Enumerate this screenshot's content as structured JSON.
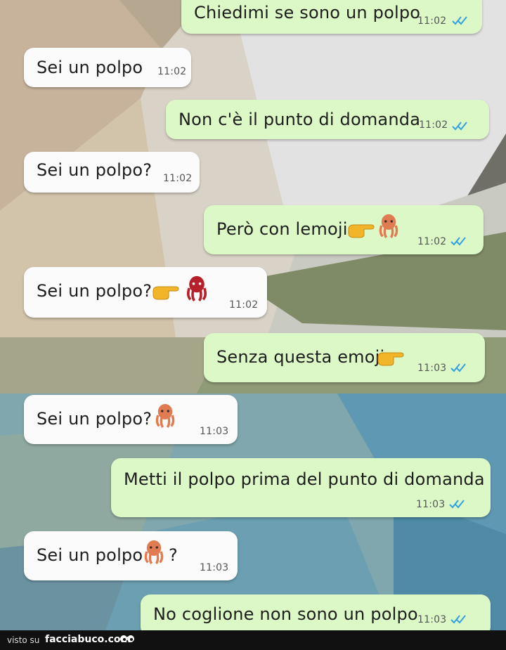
{
  "messages": [
    {
      "direction": "out",
      "text": "Chiedimi se sono un polpo",
      "time": "11:02"
    },
    {
      "direction": "in",
      "text": "Sei un polpo",
      "time": "11:02"
    },
    {
      "direction": "out",
      "text": "Non c'è il punto di domanda",
      "time": "11:02"
    },
    {
      "direction": "in",
      "text": "Sei un polpo?",
      "time": "11:02"
    },
    {
      "direction": "out",
      "text": "Però con lemoji",
      "time": "11:02",
      "emojis": [
        "pointing-right-hand",
        "octopus"
      ]
    },
    {
      "direction": "in",
      "text": "Sei un polpo?",
      "time": "11:02",
      "emojis": [
        "pointing-right-hand",
        "octopus"
      ]
    },
    {
      "direction": "out",
      "text": "Senza questa emoji",
      "time": "11:03",
      "emojis": [
        "pointing-right-hand"
      ]
    },
    {
      "direction": "in",
      "text": "Sei un polpo?",
      "time": "11:03",
      "emojis": [
        "octopus"
      ]
    },
    {
      "direction": "out",
      "text": "Metti il polpo prima del punto di domanda",
      "time": "11:03"
    },
    {
      "direction": "in",
      "text": "Sei un polpo",
      "text_after": "?",
      "time": "11:03",
      "emojis": [
        "octopus"
      ]
    },
    {
      "direction": "out",
      "text": "No coglione non sono un polpo",
      "time": "11:03"
    }
  ],
  "footer": {
    "prefix": "visto su",
    "brand": "facciabuco.com"
  },
  "colors": {
    "outgoing_bubble": "#dcf8c6",
    "incoming_bubble": "#fbfbfb",
    "read_ticks": "#34a0e0"
  }
}
